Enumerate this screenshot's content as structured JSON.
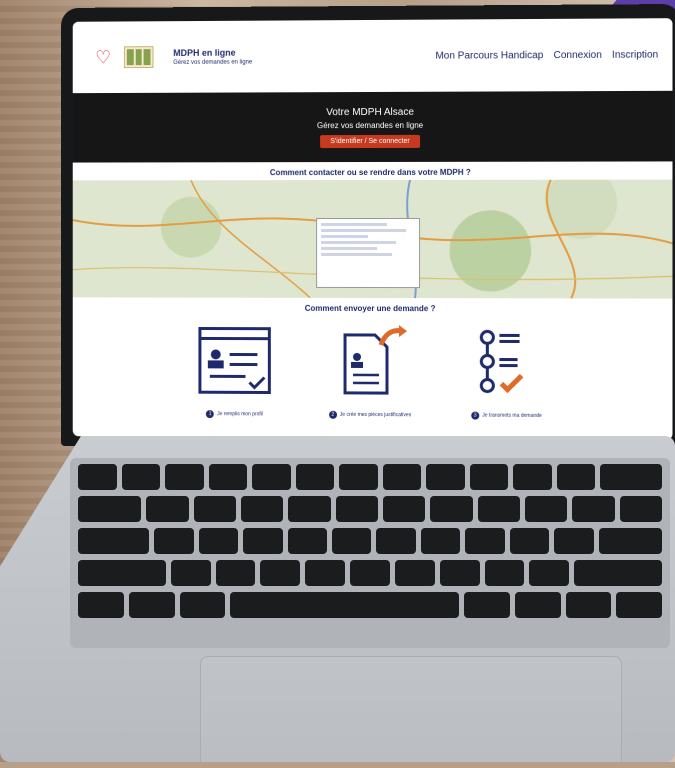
{
  "site": {
    "brand_title": "MDPH en ligne",
    "brand_sub": "Gérez vos demandes en ligne",
    "nav_links": [
      "Mon Parcours Handicap",
      "Connexion",
      "Inscription"
    ]
  },
  "hero": {
    "title": "Votre MDPH Alsace",
    "subtitle": "Gérez vos demandes en ligne",
    "button": "S'identifier / Se connecter"
  },
  "contact_title": "Comment contacter ou se rendre dans votre MDPH ?",
  "send_title": "Comment envoyer une demande ?",
  "steps": [
    {
      "num": "1",
      "caption": "Je remplis mon profil"
    },
    {
      "num": "2",
      "caption": "Je crée mes pièces justificatives"
    },
    {
      "num": "3",
      "caption": "Je transmets ma demande"
    }
  ],
  "colors": {
    "navy": "#1e2a6b",
    "accent": "#c73a1f",
    "orange": "#e06a2a"
  }
}
